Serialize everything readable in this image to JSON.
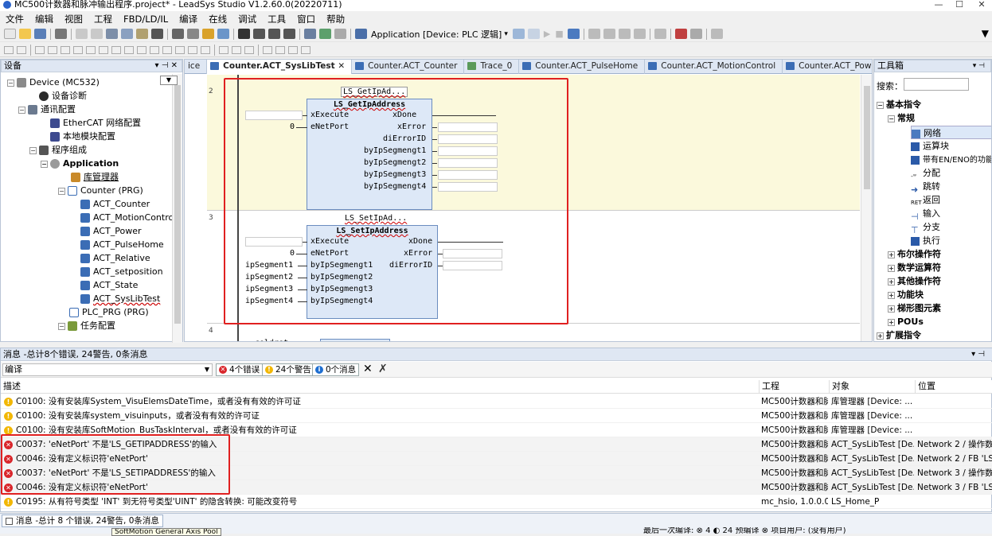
{
  "window": {
    "title": "MC500计数器和脉冲输出程序.project* - LeadSys Studio V1.2.60.0(20220711)",
    "controls": [
      "—",
      "☐",
      "✕"
    ]
  },
  "menu": [
    "文件",
    "编辑",
    "视图",
    "工程",
    "FBD/LD/IL",
    "编译",
    "在线",
    "调试",
    "工具",
    "窗口",
    "帮助"
  ],
  "toolbar": {
    "application_label": "Application [Device: PLC 逻辑]"
  },
  "device_panel": {
    "title": "设备",
    "pin": "▾ ⊣ ✕",
    "items": [
      {
        "label": "Device (MC532)"
      },
      {
        "label": "设备诊断"
      },
      {
        "label": "通讯配置"
      },
      {
        "label": "EtherCAT 网络配置"
      },
      {
        "label": "本地模块配置"
      },
      {
        "label": "程序组成"
      },
      {
        "label": "Application"
      },
      {
        "label": "库管理器"
      },
      {
        "label": "Counter (PRG)"
      },
      {
        "label": "ACT_Counter"
      },
      {
        "label": "ACT_MotionControl"
      },
      {
        "label": "ACT_Power"
      },
      {
        "label": "ACT_PulseHome"
      },
      {
        "label": "ACT_Relative"
      },
      {
        "label": "ACT_setposition"
      },
      {
        "label": "ACT_State"
      },
      {
        "label": "ACT_SysLibTest"
      },
      {
        "label": "PLC_PRG (PRG)"
      },
      {
        "label": "任务配置"
      }
    ]
  },
  "editor": {
    "tabs": [
      {
        "label": "ice"
      },
      {
        "label": "Counter.ACT_SysLibTest",
        "close": "✕"
      },
      {
        "label": "Counter.ACT_Counter"
      },
      {
        "label": "Trace_0"
      },
      {
        "label": "Counter.ACT_PulseHome"
      },
      {
        "label": "Counter.ACT_MotionControl"
      },
      {
        "label": "Counter.ACT_Powe"
      }
    ],
    "tab_overflow": "▾",
    "networks": {
      "n2": "2",
      "n3": "3",
      "n4": "4"
    },
    "fb1": {
      "instance": "LS_GetIpAd...",
      "type": "LS_GetIpAddress",
      "inputs": [
        "xExecute",
        "eNetPort"
      ],
      "outputs": [
        "xDone",
        "xError",
        "diErrorID",
        "byIpSegmengt1",
        "byIpSegmengt2",
        "byIpSegmengt3",
        "byIpSegmengt4"
      ],
      "eNetPort_value": "0"
    },
    "fb2": {
      "instance": "LS_SetIpAd...",
      "type": "LS_SetIpAddress",
      "inputs": [
        "xExecute",
        "eNetPort",
        "byIpSegmengt1",
        "byIpSegmengt2",
        "byIpSegmengt3",
        "byIpSegmengt4"
      ],
      "outputs": [
        "xDone",
        "xError",
        "diErrorID"
      ],
      "input_values": [
        "",
        "0",
        "ipSegment1",
        "ipSegment2",
        "ipSegment3",
        "ipSegment4"
      ]
    },
    "net4_fragment": "coldrst"
  },
  "toolbox": {
    "title": "工具箱",
    "search_label": "搜索：",
    "items": [
      {
        "label": "基本指令"
      },
      {
        "label": "常规"
      },
      {
        "label": "网络"
      },
      {
        "label": "运算块"
      },
      {
        "label": "带有EN/ENO的功能"
      },
      {
        "label": "分配"
      },
      {
        "label": "跳转"
      },
      {
        "label": "返回"
      },
      {
        "label": "输入"
      },
      {
        "label": "分支"
      },
      {
        "label": "执行"
      },
      {
        "label": "布尔操作符"
      },
      {
        "label": "数学运算符"
      },
      {
        "label": "其他操作符"
      },
      {
        "label": "功能块"
      },
      {
        "label": "梯形图元素"
      },
      {
        "label": "POUs"
      },
      {
        "label": "扩展指令"
      }
    ]
  },
  "messages": {
    "title": "消息 -总计8个错误, 24警告, 0条消息",
    "category": "编译",
    "errors_btn": "4个错误",
    "warnings_btn": "24个警告",
    "info_btn": "0个消息",
    "columns": [
      "描述",
      "工程",
      "对象",
      "位置"
    ],
    "rows": [
      {
        "type": "warning",
        "desc": "C0100: 没有安装库System_VisuElemsDateTime，或者没有有效的许可证",
        "project": "MC500计数器和脉...",
        "object": "库管理器 [Device: ...",
        "position": ""
      },
      {
        "type": "warning",
        "desc": "C0100: 没有安装库system_visuinputs，或者没有有效的许可证",
        "project": "MC500计数器和脉...",
        "object": "库管理器 [Device: ...",
        "position": ""
      },
      {
        "type": "warning",
        "desc": "C0100: 没有安装库SoftMotion_BusTaskInterval，或者没有有效的许可证",
        "project": "MC500计数器和脉...",
        "object": "库管理器 [Device: ...",
        "position": ""
      },
      {
        "type": "error",
        "desc": "C0037: 'eNetPort' 不是'LS_GETIPADDRESS'的输入",
        "project": "MC500计数器和脉...",
        "object": "ACT_SysLibTest [De...",
        "position": "Network 2 / 操作数 ..."
      },
      {
        "type": "error",
        "desc": "C0046: 没有定义标识符'eNetPort'",
        "project": "MC500计数器和脉...",
        "object": "ACT_SysLibTest [De...",
        "position": "Network 2 / FB 'LS_..."
      },
      {
        "type": "error",
        "desc": "C0037: 'eNetPort' 不是'LS_SETIPADDRESS'的输入",
        "project": "MC500计数器和脉...",
        "object": "ACT_SysLibTest [De...",
        "position": "Network 3 / 操作数 ..."
      },
      {
        "type": "error",
        "desc": "C0046: 没有定义标识符'eNetPort'",
        "project": "MC500计数器和脉...",
        "object": "ACT_SysLibTest [De...",
        "position": "Network 3 / FB 'LS_S..."
      },
      {
        "type": "warning",
        "desc": "C0195: 从有符号类型 'INT' 到无符号类型'UINT' 的隐含转换: 可能改变符号",
        "project": "mc_hsio, 1.0.0.0 (le...",
        "object": "LS_Home_P",
        "position": ""
      }
    ]
  },
  "statusbar": {
    "tab_label": "消息 -总计 8 个错误, 24警告, 0条消息",
    "tooltip": "SoftMotion General Axis Pool",
    "right_text": "最后一次编译: ⊗ 4 ◐ 24    预编译 ⊗    项目用户: (没有用户)"
  },
  "colors": {
    "panel_header": "#dfe7f3",
    "highlight_red": "#e02020",
    "error": "#d9262b",
    "warning": "#f2b705",
    "info": "#1f6fd1",
    "network_bg": "#fbf9dc",
    "fb_fill": "#dde8f7"
  }
}
